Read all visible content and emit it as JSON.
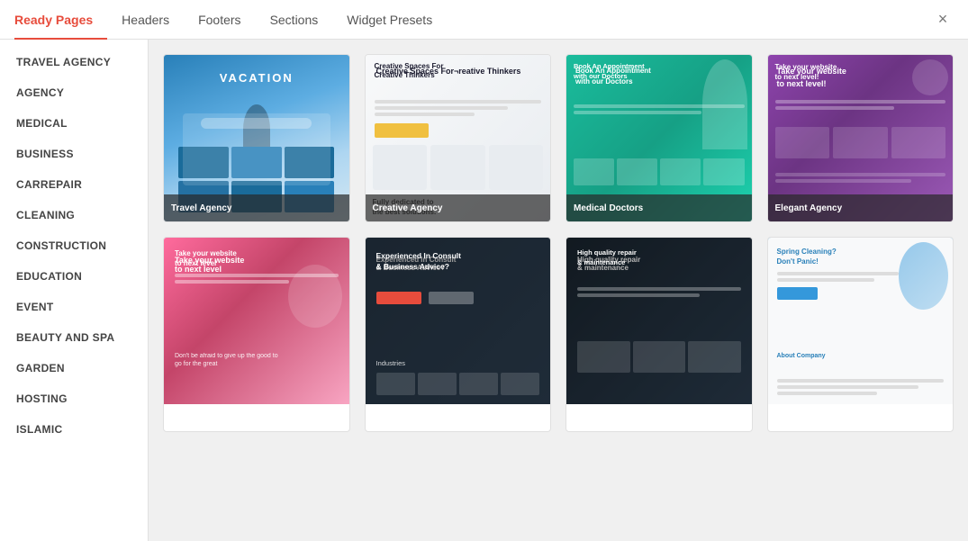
{
  "header": {
    "tabs": [
      {
        "id": "ready-pages",
        "label": "Ready Pages",
        "active": true
      },
      {
        "id": "headers",
        "label": "Headers",
        "active": false
      },
      {
        "id": "footers",
        "label": "Footers",
        "active": false
      },
      {
        "id": "sections",
        "label": "Sections",
        "active": false
      },
      {
        "id": "widget-presets",
        "label": "Widget Presets",
        "active": false
      }
    ],
    "close_label": "×"
  },
  "sidebar": {
    "items": [
      {
        "id": "travel-agency",
        "label": "TRAVEL AGENCY"
      },
      {
        "id": "agency",
        "label": "AGENCY"
      },
      {
        "id": "medical",
        "label": "MEDICAL"
      },
      {
        "id": "business",
        "label": "BUSINESS"
      },
      {
        "id": "carrepair",
        "label": "CARREPAIR"
      },
      {
        "id": "cleaning",
        "label": "CLEANING"
      },
      {
        "id": "construction",
        "label": "CONSTRUCTION"
      },
      {
        "id": "education",
        "label": "EDUCATION"
      },
      {
        "id": "event",
        "label": "EVENT"
      },
      {
        "id": "beauty-and-spa",
        "label": "BEAUTY AND SPA"
      },
      {
        "id": "garden",
        "label": "GARDEN"
      },
      {
        "id": "hosting",
        "label": "HOSTING"
      },
      {
        "id": "islamic",
        "label": "ISLAMIC"
      }
    ]
  },
  "cards": {
    "row1": [
      {
        "id": "travel-agency",
        "label": "Travel Agency",
        "preview_type": "travel"
      },
      {
        "id": "creative-agency",
        "label": "Creative Agency",
        "preview_type": "creative"
      },
      {
        "id": "medical-doctors",
        "label": "Medical Doctors",
        "preview_type": "medical"
      },
      {
        "id": "elegant-agency",
        "label": "Elegant Agency",
        "preview_type": "elegant"
      }
    ],
    "row2": [
      {
        "id": "agency2",
        "label": "",
        "preview_type": "agency2"
      },
      {
        "id": "business2",
        "label": "",
        "preview_type": "business"
      },
      {
        "id": "repair",
        "label": "",
        "preview_type": "repair"
      },
      {
        "id": "cleaning",
        "label": "",
        "preview_type": "cleaning"
      }
    ]
  },
  "colors": {
    "accent": "#e74c3c",
    "active_tab_underline": "#e74c3c"
  }
}
